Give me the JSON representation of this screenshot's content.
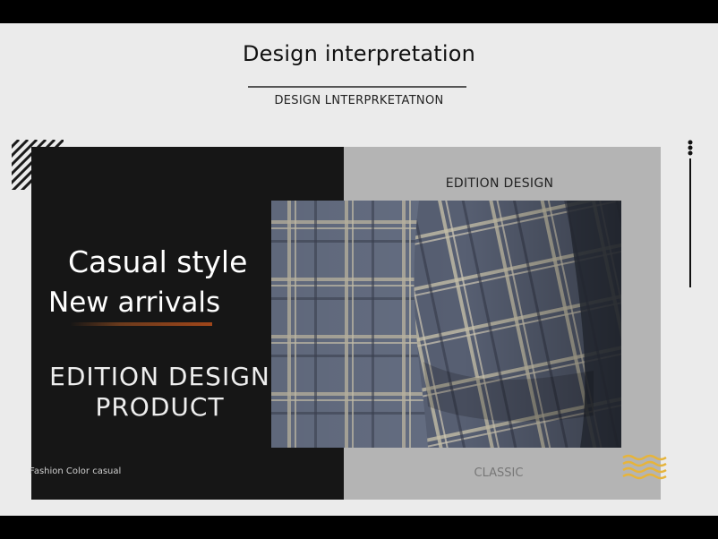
{
  "header": {
    "title": "Design interpretation",
    "subtitle": "DESIGN LNTERPRKETATNON"
  },
  "left_panel": {
    "headline_1": "Casual style",
    "headline_2": "New arrivals",
    "product_line_1": "EDITION DESIGN",
    "product_line_2": "PRODUCT",
    "caption": "Fashion Color casual"
  },
  "right_panel": {
    "label_top": "EDITION DESIGN",
    "label_bottom": "CLASSIC"
  },
  "decor": {
    "hatch_icon": "diagonal-stripes-icon",
    "dots_icon": "vertical-dots-line-icon",
    "waves_icon": "wave-lines-icon",
    "photo_subject": "plaid-fabric-sleeve",
    "colors": {
      "background": "#ebebeb",
      "black_panel": "#161616",
      "gray_panel": "#b4b4b4",
      "accent_orange": "#a0461a",
      "accent_gold": "#e6b43c"
    }
  }
}
